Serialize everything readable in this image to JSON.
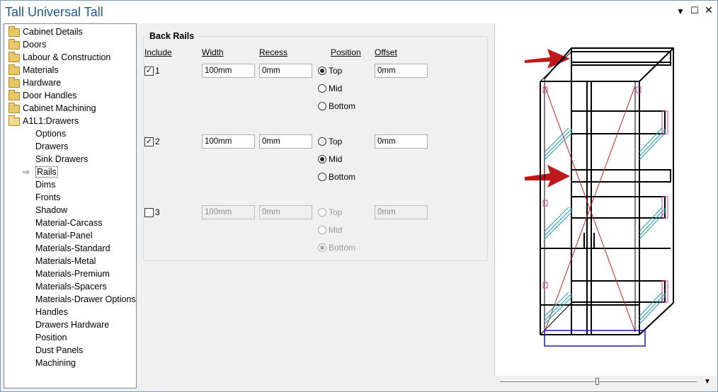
{
  "window": {
    "title": "Tall Universal Tall",
    "controls": [
      "▼",
      "☐",
      "✕"
    ]
  },
  "tree": {
    "folders": [
      {
        "label": "Cabinet Details"
      },
      {
        "label": "Doors"
      },
      {
        "label": "Labour & Construction"
      },
      {
        "label": "Materials"
      },
      {
        "label": "Hardware"
      },
      {
        "label": "Door Handles"
      },
      {
        "label": "Cabinet Machining"
      },
      {
        "label": "A1L1:Drawers"
      }
    ],
    "children": [
      "Options",
      "Drawers",
      "Sink Drawers",
      "Rails",
      "Dims",
      "Fronts",
      "Shadow",
      "Material-Carcass",
      "Material-Panel",
      "Materials-Standard",
      "Materials-Metal",
      "Materials-Premium",
      "Materials-Spacers",
      "Materials-Drawer Options",
      "Handles",
      "Drawers Hardware",
      "Position",
      "Dust Panels",
      "Machining"
    ],
    "selected": "Rails"
  },
  "back_rails": {
    "group_title": "Back Rails",
    "headers": {
      "include": "Include",
      "width": "Width",
      "recess": "Recess",
      "position": "Position",
      "offset": "Offset"
    },
    "rows": [
      {
        "label": "1",
        "include": true,
        "width": "100mm",
        "recess": "0mm",
        "offset": "0mm",
        "position": "Top",
        "enabled": true,
        "options": [
          "Top",
          "Mid",
          "Bottom"
        ]
      },
      {
        "label": "2",
        "include": true,
        "width": "100mm",
        "recess": "0mm",
        "offset": "0mm",
        "position": "Mid",
        "enabled": true,
        "options": [
          "Top",
          "Mid",
          "Bottom"
        ]
      },
      {
        "label": "3",
        "include": false,
        "width": "100mm",
        "recess": "0mm",
        "offset": "0mm",
        "position": "Bottom",
        "enabled": false,
        "options": [
          "Top",
          "Mid",
          "Bottom"
        ]
      }
    ]
  },
  "colors": {
    "title": "#1e5a9b",
    "arrow": "#c0181a",
    "carcass": "#000000",
    "drawer_runners": "#1a9bb5",
    "diagonal": "#d02020",
    "hardware": "#d040a0",
    "plinth": "#1a1aaa"
  }
}
